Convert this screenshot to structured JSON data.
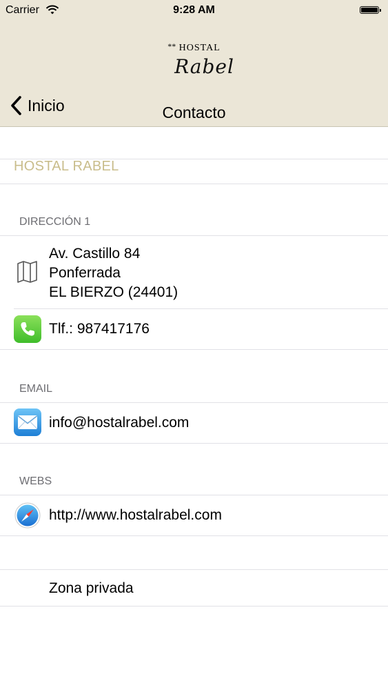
{
  "status_bar": {
    "carrier": "Carrier",
    "time": "9:28 AM"
  },
  "logo": {
    "stars": "**",
    "hostal": "HOSTAL",
    "name": "Rabel"
  },
  "nav": {
    "back_label": "Inicio",
    "title": "Contacto"
  },
  "hostal_name": "HOSTAL RABEL",
  "sections": {
    "address": {
      "header": "DIRECCIÓN 1",
      "lines": [
        "Av. Castillo 84",
        "Ponferrada",
        "EL BIERZO (24401)"
      ],
      "phone": "Tlf.: 987417176"
    },
    "email": {
      "header": "EMAIL",
      "value": "info@hostalrabel.com"
    },
    "webs": {
      "header": "WEBS",
      "value": "http://www.hostalrabel.com"
    }
  },
  "private_zone": "Zona privada",
  "icons": [
    "wifi-icon",
    "battery-icon",
    "chevron-left-icon",
    "map-icon",
    "phone-icon",
    "mail-icon",
    "safari-icon"
  ]
}
